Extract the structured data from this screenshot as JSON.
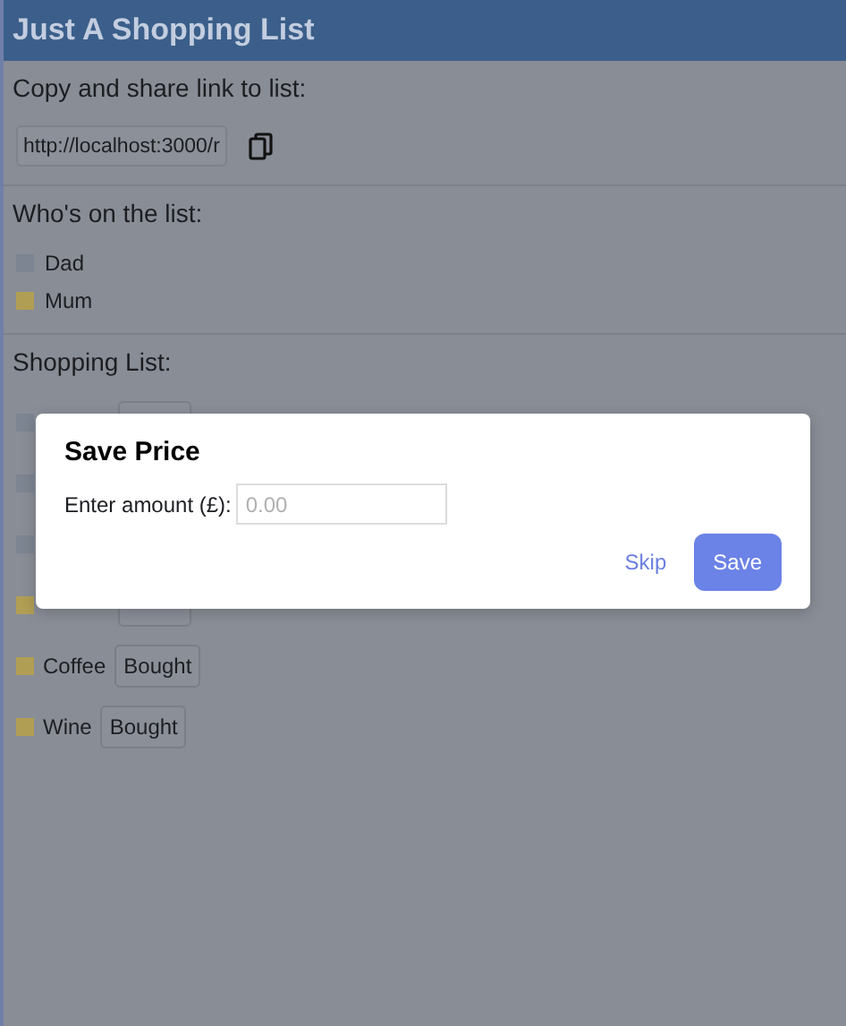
{
  "header": {
    "title": "Just A Shopping List"
  },
  "share": {
    "label": "Copy and share link to list:",
    "link": "http://localhost:3000/r"
  },
  "members": {
    "label": "Who's on the list:",
    "people": [
      {
        "name": "Dad",
        "color": "#7c8591"
      },
      {
        "name": "Mum",
        "color": "#b09e54"
      }
    ]
  },
  "shopping": {
    "label": "Shopping List:",
    "items": [
      {
        "kind": "covered-button",
        "color": "#7c8591"
      },
      {
        "kind": "covered",
        "color": "#7c8591"
      },
      {
        "kind": "covered",
        "color": "#7c8591"
      },
      {
        "kind": "covered-button",
        "color": "#b09e54"
      },
      {
        "kind": "item",
        "color": "#b09e54",
        "name": "Coffee",
        "button": "Bought"
      },
      {
        "kind": "item",
        "color": "#b09e54",
        "name": "Wine",
        "button": "Bought"
      }
    ]
  },
  "dialog": {
    "title": "Save Price",
    "label": "Enter amount (£):",
    "placeholder": "0.00",
    "buttons": [
      {
        "kind": "link",
        "label": "Skip"
      },
      {
        "kind": "primary",
        "label": "Save"
      }
    ]
  }
}
